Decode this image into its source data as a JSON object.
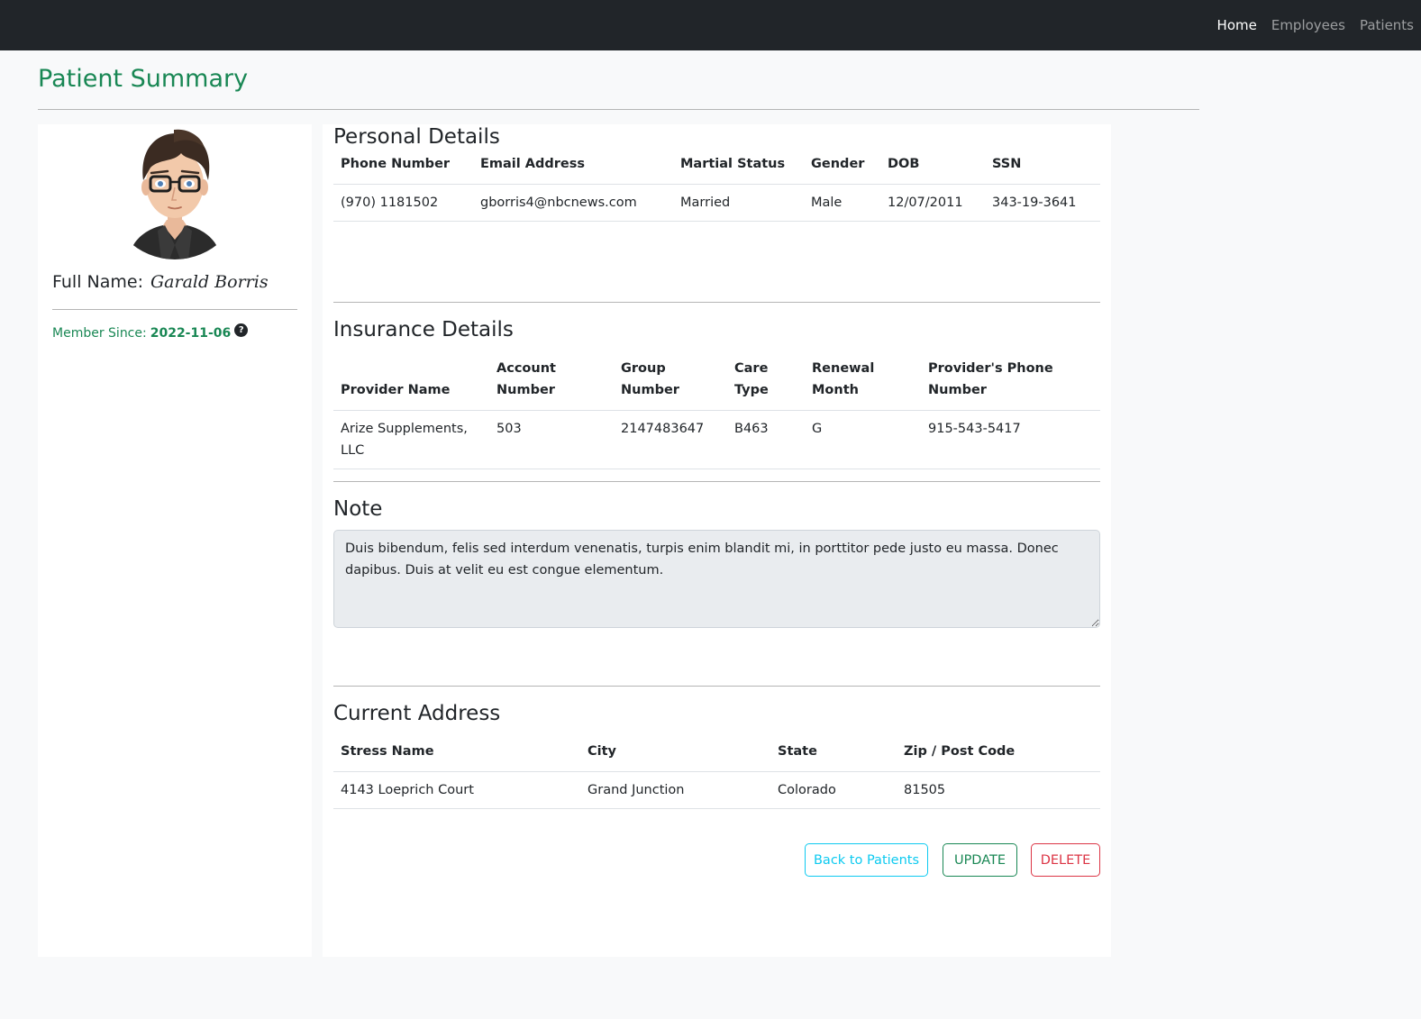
{
  "nav": {
    "links": [
      "Home",
      "Employees",
      "Patients"
    ]
  },
  "page_title": "Patient Summary",
  "profile": {
    "full_name_label": "Full Name:",
    "full_name": "Garald Borris",
    "member_since_label": "Member Since:",
    "member_since": "2022-11-06",
    "help_icon": "?"
  },
  "personal": {
    "title": "Personal Details",
    "headers": [
      "Phone Number",
      "Email Address",
      "Martial Status",
      "Gender",
      "DOB",
      "SSN"
    ],
    "row": [
      "(970) 1181502",
      "gborris4@nbcnews.com",
      "Married",
      "Male",
      "12/07/2011",
      "343-19-3641"
    ]
  },
  "insurance": {
    "title": "Insurance Details",
    "headers": [
      "Provider Name",
      "Account Number",
      "Group Number",
      "Care Type",
      "Renewal Month",
      "Provider's Phone Number"
    ],
    "row": [
      "Arize Supplements, LLC",
      "503",
      "2147483647",
      "B463",
      "G",
      "915-543-5417"
    ]
  },
  "note": {
    "title": "Note",
    "text": "Duis bibendum, felis sed interdum venenatis, turpis enim blandit mi, in porttitor pede justo eu massa. Donec dapibus. Duis at velit eu est congue elementum."
  },
  "address": {
    "title": "Current Address",
    "headers": [
      "Stress Name",
      "City",
      "State",
      "Zip / Post Code"
    ],
    "row": [
      "4143 Loeprich Court",
      "Grand Junction",
      "Colorado",
      "81505"
    ]
  },
  "buttons": {
    "back": "Back to Patients",
    "update": "UPDATE",
    "delete": "DELETE"
  }
}
